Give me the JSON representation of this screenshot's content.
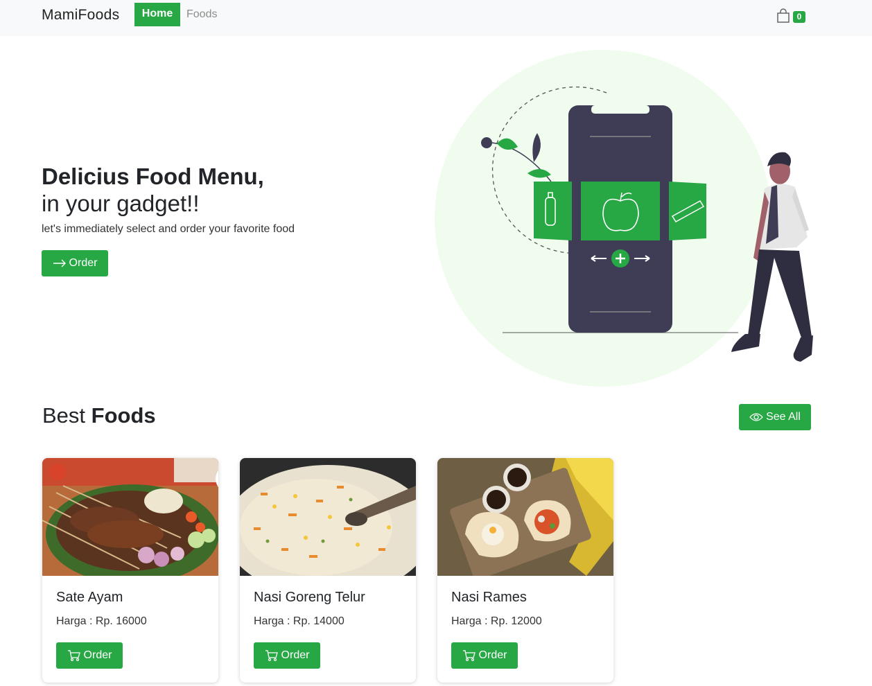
{
  "navbar": {
    "brand": "MamiFoods",
    "home": "Home",
    "foods": "Foods",
    "cart_count": "0"
  },
  "hero": {
    "title": "Delicius Food Menu,",
    "subtitle": "in your gadget!!",
    "description": "let's immediately select and order your favorite food",
    "order_button": "Order"
  },
  "best": {
    "title_light": "Best ",
    "title_bold": "Foods",
    "see_all": "See All"
  },
  "foods": [
    {
      "name": "Sate Ayam",
      "price": "Harga : Rp. 16000",
      "order": "Order"
    },
    {
      "name": "Nasi Goreng Telur",
      "price": "Harga : Rp. 14000",
      "order": "Order"
    },
    {
      "name": "Nasi Rames",
      "price": "Harga : Rp. 12000",
      "order": "Order"
    }
  ],
  "colors": {
    "accent": "#28a745",
    "navbar_bg": "#f8f9fa",
    "hero_circle": "#f0fcee",
    "phone": "#3f3d56"
  },
  "icons": [
    "shopping-bag-icon",
    "arrow-right-icon",
    "eye-icon",
    "cart-icon"
  ]
}
